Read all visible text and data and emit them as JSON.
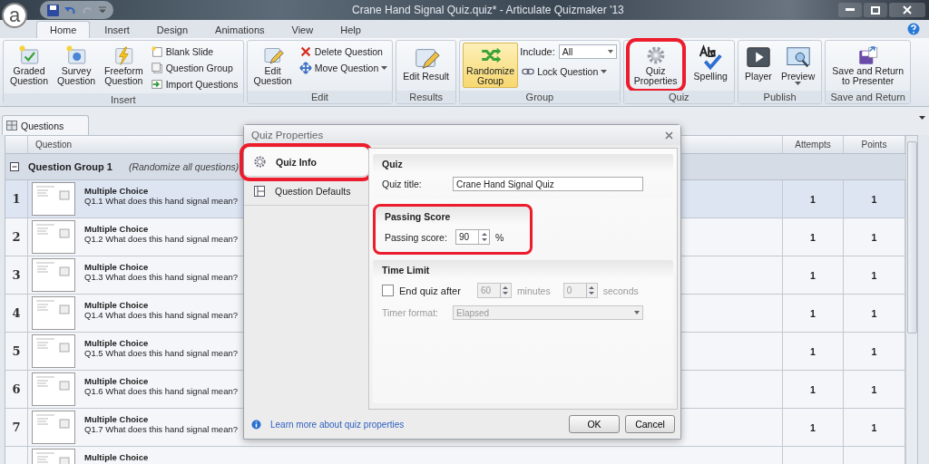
{
  "window": {
    "logo": "a",
    "title": "Crane Hand Signal Quiz.quiz*  -  Articulate Quizmaker '13"
  },
  "ribbon_tabs": [
    {
      "label": "Home",
      "selected": true
    },
    {
      "label": "Insert",
      "selected": false
    },
    {
      "label": "Design",
      "selected": false
    },
    {
      "label": "Animations",
      "selected": false
    },
    {
      "label": "View",
      "selected": false
    },
    {
      "label": "Help",
      "selected": false
    }
  ],
  "ribbon_groups": [
    {
      "label": "Insert",
      "items": [
        {
          "kind": "large",
          "label": "Graded\nQuestion"
        },
        {
          "kind": "large",
          "label": "Survey\nQuestion"
        },
        {
          "kind": "large",
          "label": "Freeform\nQuestion"
        },
        {
          "kind": "small",
          "label": "Blank Slide"
        },
        {
          "kind": "small",
          "label": "Question Group"
        },
        {
          "kind": "small",
          "label": "Import Questions"
        }
      ]
    },
    {
      "label": "Edit",
      "items": [
        {
          "kind": "large",
          "label": "Edit\nQuestion"
        },
        {
          "kind": "small",
          "label": "Delete Question"
        },
        {
          "kind": "small",
          "label": "Move Question",
          "dropdown": true
        }
      ]
    },
    {
      "label": "Results",
      "items": [
        {
          "kind": "large",
          "label": "Edit Result"
        }
      ]
    },
    {
      "label": "Group",
      "items": [
        {
          "kind": "large",
          "label": "Randomize\nGroup",
          "active": true
        },
        {
          "kind": "select",
          "label": "Include:",
          "value": "All"
        },
        {
          "kind": "small",
          "label": "Lock Question",
          "dropdown": true
        }
      ]
    },
    {
      "label": "Quiz",
      "items": [
        {
          "kind": "large",
          "label": "Quiz\nProperties",
          "highlighted": true
        },
        {
          "kind": "large",
          "label": "Spelling"
        }
      ]
    },
    {
      "label": "Publish",
      "items": [
        {
          "kind": "large",
          "label": "Player"
        },
        {
          "kind": "large",
          "label": "Preview",
          "dropdown": true
        }
      ]
    },
    {
      "label": "Save and Return",
      "items": [
        {
          "kind": "large",
          "label": "Save and Return\nto Presenter"
        }
      ]
    }
  ],
  "document_tab": {
    "label": "Questions"
  },
  "table": {
    "columns": [
      "Question",
      "Attempts",
      "Points"
    ],
    "group": {
      "title": "Question Group 1",
      "note": "(Randomize all questions)",
      "expanded": true
    },
    "rows": [
      {
        "number": "1",
        "type": "Multiple Choice",
        "text": "Q1.1 What does this hand signal mean?",
        "attempts": "1",
        "points": "1",
        "selected": true
      },
      {
        "number": "2",
        "type": "Multiple Choice",
        "text": "Q1.2 What does this hand signal mean?",
        "attempts": "1",
        "points": "1",
        "selected": false
      },
      {
        "number": "3",
        "type": "Multiple Choice",
        "text": "Q1.3 What does this hand signal mean?",
        "attempts": "1",
        "points": "1",
        "selected": false
      },
      {
        "number": "4",
        "type": "Multiple Choice",
        "text": "Q1.4 What does this hand signal mean?",
        "attempts": "1",
        "points": "1",
        "selected": false
      },
      {
        "number": "5",
        "type": "Multiple Choice",
        "text": "Q1.5 What does this hand signal mean?",
        "attempts": "1",
        "points": "1",
        "selected": false
      },
      {
        "number": "6",
        "type": "Multiple Choice",
        "text": "Q1.6 What does this hand signal mean?",
        "attempts": "1",
        "points": "1",
        "selected": false
      },
      {
        "number": "7",
        "type": "Multiple Choice",
        "text": "Q1.7 What does this hand signal mean?",
        "attempts": "1",
        "points": "1",
        "selected": false
      },
      {
        "type": "Multiple Choice",
        "selected": false
      }
    ]
  },
  "dialog": {
    "title": "Quiz Properties",
    "nav": [
      {
        "label": "Quiz Info",
        "selected": true,
        "highlighted": true
      },
      {
        "label": "Question Defaults",
        "selected": false,
        "highlighted": false
      }
    ],
    "quiz_section": {
      "title": "Quiz",
      "label": "Quiz title:",
      "value": "Crane Hand Signal Quiz"
    },
    "passing_section": {
      "title": "Passing Score",
      "highlighted": true,
      "label": "Passing score:",
      "value": "90",
      "unit": "%"
    },
    "time_section": {
      "title": "Time Limit",
      "end_quiz": {
        "label": "End quiz after",
        "checked": false
      },
      "minutes": {
        "value": "60",
        "unit": "minutes",
        "disabled": true
      },
      "seconds": {
        "value": "0",
        "unit": "seconds",
        "disabled": true
      },
      "timer_format": {
        "label": "Timer format:",
        "value": "Elapsed",
        "disabled": true
      }
    },
    "help_link": "Learn more about quiz properties",
    "buttons": [
      "OK",
      "Cancel"
    ]
  }
}
